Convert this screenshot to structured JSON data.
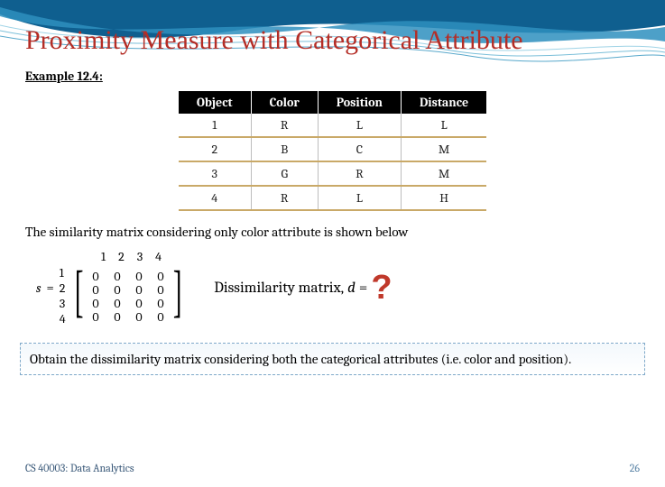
{
  "title": "Proximity Measure with Categorical Attribute",
  "example_label": "Example 12.4:",
  "table": {
    "headers": [
      "Object",
      "Color",
      "Position",
      "Distance"
    ],
    "rows": [
      [
        "1",
        "R",
        "L",
        "L"
      ],
      [
        "2",
        "B",
        "C",
        "M"
      ],
      [
        "3",
        "G",
        "R",
        "M"
      ],
      [
        "4",
        "R",
        "L",
        "H"
      ]
    ]
  },
  "body_text": "The similarity matrix considering only color attribute is shown below",
  "matrix": {
    "var": "s",
    "eq": "=",
    "col_labels": [
      "1",
      "2",
      "3",
      "4"
    ],
    "row_labels": [
      "1",
      "2",
      "3",
      "4"
    ],
    "cells": [
      [
        "0",
        "0",
        "0",
        "0"
      ],
      [
        "0",
        "0",
        "0",
        "0"
      ],
      [
        "0",
        "0",
        "0",
        "0"
      ],
      [
        "0",
        "0",
        "0",
        "0"
      ]
    ]
  },
  "dissim": {
    "label": "Dissimilarity matrix,",
    "var": "d",
    "eq": "=",
    "mark": "?"
  },
  "task": "Obtain the dissimilarity matrix considering both the categorical attributes (i.e. color and position).",
  "footer": {
    "course": "CS 40003: Data Analytics",
    "page": "26"
  },
  "chart_data": {
    "type": "table",
    "title": "Proximity Measure with Categorical Attribute — Example 12.4",
    "columns": [
      "Object",
      "Color",
      "Position",
      "Distance"
    ],
    "rows": [
      {
        "Object": 1,
        "Color": "R",
        "Position": "L",
        "Distance": "L"
      },
      {
        "Object": 2,
        "Color": "B",
        "Position": "C",
        "Distance": "M"
      },
      {
        "Object": 3,
        "Color": "G",
        "Position": "R",
        "Distance": "M"
      },
      {
        "Object": 4,
        "Color": "R",
        "Position": "L",
        "Distance": "H"
      }
    ],
    "similarity_matrix_color_only": {
      "labels": [
        1,
        2,
        3,
        4
      ],
      "values": [
        [
          0,
          0,
          0,
          0
        ],
        [
          0,
          0,
          0,
          0
        ],
        [
          0,
          0,
          0,
          0
        ],
        [
          0,
          0,
          0,
          0
        ]
      ]
    }
  }
}
